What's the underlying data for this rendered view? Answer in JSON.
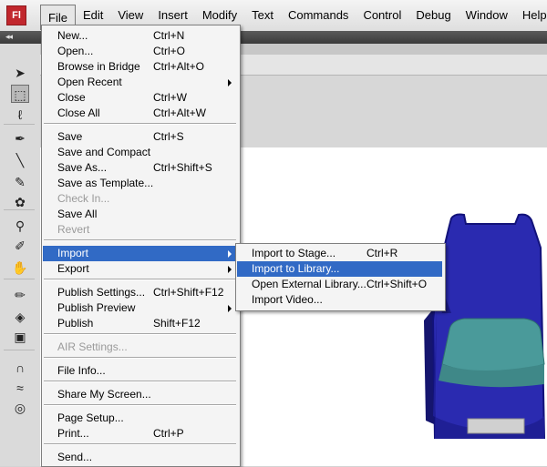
{
  "app": {
    "logo_text": "Fl"
  },
  "menubar": {
    "items": [
      {
        "label": "File"
      },
      {
        "label": "Edit"
      },
      {
        "label": "View"
      },
      {
        "label": "Insert"
      },
      {
        "label": "Modify"
      },
      {
        "label": "Text"
      },
      {
        "label": "Commands"
      },
      {
        "label": "Control"
      },
      {
        "label": "Debug"
      },
      {
        "label": "Window"
      },
      {
        "label": "Help"
      }
    ],
    "active": "File"
  },
  "panel_strip": {
    "arrows": "◂◂"
  },
  "file_menu": {
    "items": [
      {
        "label": "New...",
        "shortcut": "Ctrl+N"
      },
      {
        "label": "Open...",
        "shortcut": "Ctrl+O"
      },
      {
        "label": "Browse in Bridge",
        "shortcut": "Ctrl+Alt+O"
      },
      {
        "label": "Open Recent",
        "shortcut": "",
        "submenu": true
      },
      {
        "label": "Close",
        "shortcut": "Ctrl+W"
      },
      {
        "label": "Close All",
        "shortcut": "Ctrl+Alt+W"
      },
      {
        "label": "Save",
        "shortcut": "Ctrl+S"
      },
      {
        "label": "Save and Compact",
        "shortcut": ""
      },
      {
        "label": "Save As...",
        "shortcut": "Ctrl+Shift+S"
      },
      {
        "label": "Save as Template...",
        "shortcut": ""
      },
      {
        "label": "Check In...",
        "shortcut": "",
        "disabled": true
      },
      {
        "label": "Save All",
        "shortcut": ""
      },
      {
        "label": "Revert",
        "shortcut": "",
        "disabled": true
      },
      {
        "label": "Import",
        "shortcut": "",
        "submenu": true,
        "highlighted": true
      },
      {
        "label": "Export",
        "shortcut": "",
        "submenu": true
      },
      {
        "label": "Publish Settings...",
        "shortcut": "Ctrl+Shift+F12"
      },
      {
        "label": "Publish Preview",
        "shortcut": "",
        "submenu": true
      },
      {
        "label": "Publish",
        "shortcut": "Shift+F12"
      },
      {
        "label": "AIR Settings...",
        "shortcut": "",
        "disabled": true
      },
      {
        "label": "File Info...",
        "shortcut": ""
      },
      {
        "label": "Share My Screen...",
        "shortcut": ""
      },
      {
        "label": "Page Setup...",
        "shortcut": ""
      },
      {
        "label": "Print...",
        "shortcut": "Ctrl+P"
      },
      {
        "label": "Send...",
        "shortcut": ""
      }
    ]
  },
  "import_submenu": {
    "items": [
      {
        "label": "Import to Stage...",
        "shortcut": "Ctrl+R"
      },
      {
        "label": "Import to Library...",
        "shortcut": "",
        "highlighted": true
      },
      {
        "label": "Open External Library...",
        "shortcut": "Ctrl+Shift+O"
      },
      {
        "label": "Import Video...",
        "shortcut": ""
      }
    ]
  },
  "tools": [
    {
      "name": "selection-tool-icon",
      "glyph": "➤"
    },
    {
      "name": "subselection-tool-icon",
      "glyph": "⬚"
    },
    {
      "name": "lasso-tool-icon",
      "glyph": "ℓ"
    },
    {
      "name": "pen-tool-icon",
      "glyph": "✒"
    },
    {
      "name": "line-tool-icon",
      "glyph": "╲"
    },
    {
      "name": "pencil-tool-icon",
      "glyph": "✎"
    },
    {
      "name": "deco-tool-icon",
      "glyph": "✿"
    },
    {
      "name": "bone-tool-icon",
      "glyph": "⚲"
    },
    {
      "name": "eyedropper-tool-icon",
      "glyph": "✐"
    },
    {
      "name": "hand-tool-icon",
      "glyph": "✋"
    },
    {
      "name": "stroke-color-icon",
      "glyph": "✏"
    },
    {
      "name": "fill-color-icon",
      "glyph": "◈"
    },
    {
      "name": "swap-colors-icon",
      "glyph": "▣"
    },
    {
      "name": "snap-magnet-icon",
      "glyph": "∩"
    },
    {
      "name": "smooth-icon",
      "glyph": "≈"
    },
    {
      "name": "straighten-icon",
      "glyph": "◎"
    }
  ],
  "colors": {
    "highlight": "#316ac5",
    "car_body": "#2626a8",
    "car_window": "#4a9a9a",
    "logo": "#c1272d"
  }
}
